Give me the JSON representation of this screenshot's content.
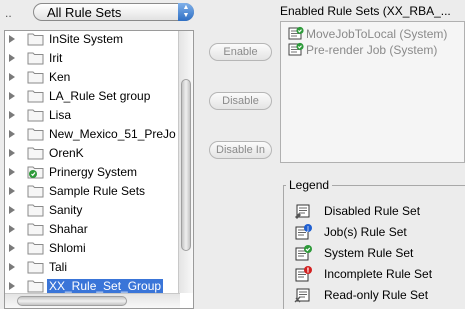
{
  "rule_set_selector": {
    "value": "All Rule Sets"
  },
  "tree": {
    "top_dots": "..",
    "items": [
      {
        "label": "InSite System"
      },
      {
        "label": "Irit"
      },
      {
        "label": "Ken"
      },
      {
        "label": "LA_Rule Set group"
      },
      {
        "label": "Lisa"
      },
      {
        "label": "New_Mexico_51_PreJo"
      },
      {
        "label": "OrenK"
      },
      {
        "label": "Prinergy System"
      },
      {
        "label": "Sample Rule Sets"
      },
      {
        "label": "Sanity"
      },
      {
        "label": "Shahar"
      },
      {
        "label": "Shlomi"
      },
      {
        "label": "Tali"
      },
      {
        "label": "XX_Rule_Set_Group",
        "selected": true
      }
    ]
  },
  "buttons": {
    "enable": "Enable",
    "disable": "Disable",
    "disable_in": "Disable In"
  },
  "enabled_rule_sets": {
    "title": "Enabled Rule Sets (XX_RBA_...",
    "items": [
      {
        "label": "MoveJobToLocal (System)",
        "icon": "system-rule-set-icon"
      },
      {
        "label": "Pre-render Job (System)",
        "icon": "system-rule-set-icon"
      }
    ]
  },
  "legend": {
    "title": "Legend",
    "items": [
      {
        "label": "Disabled Rule Set",
        "icon": "disabled-rule-set-icon"
      },
      {
        "label": "Job(s) Rule Set",
        "icon": "jobs-rule-set-icon"
      },
      {
        "label": "System Rule Set",
        "icon": "system-rule-set-icon"
      },
      {
        "label": "Incomplete Rule Set",
        "icon": "incomplete-rule-set-icon"
      },
      {
        "label": "Read-only Rule Set",
        "icon": "read-only-rule-set-icon"
      }
    ]
  },
  "colors": {
    "selection": "#3a75d8",
    "jobs_badge": "#1f5fd1",
    "system_badge": "#2e9a3a",
    "incomplete_badge": "#d32020"
  }
}
